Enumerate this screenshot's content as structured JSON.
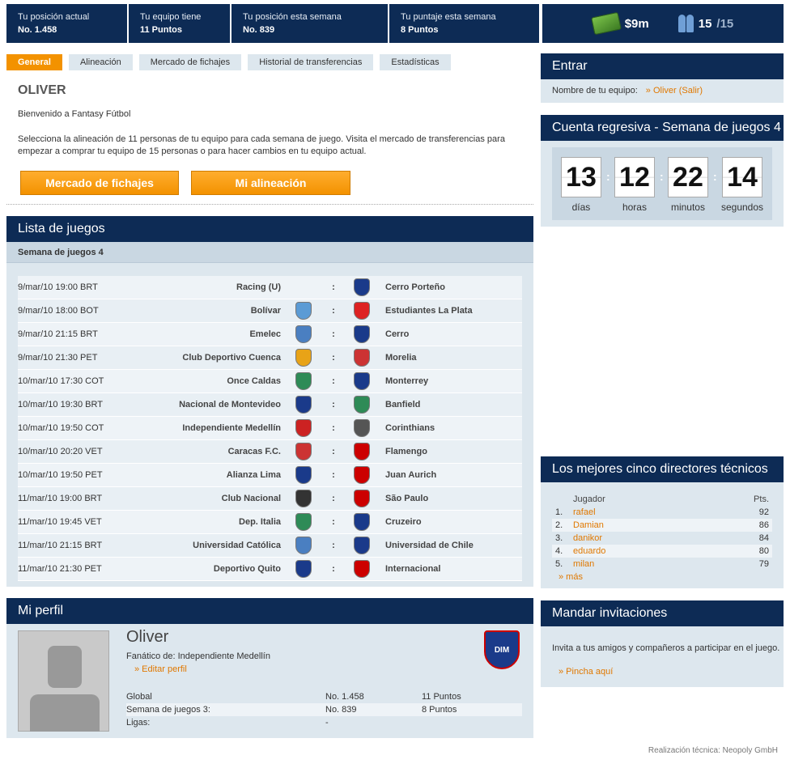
{
  "stats": [
    {
      "label": "Tu posición actual",
      "value": "No. 1.458"
    },
    {
      "label": "Tu equipo tiene",
      "value": "11 Puntos"
    },
    {
      "label": "Tu posición esta semana",
      "value": "No. 839"
    },
    {
      "label": "Tu puntaje esta semana",
      "value": "8 Puntos"
    }
  ],
  "budget": "$9m",
  "players": {
    "count": "15",
    "max": "/15"
  },
  "tabs": [
    "General",
    "Alineación",
    "Mercado de fichajes",
    "Historial de transferencias",
    "Estadísticas"
  ],
  "general": {
    "title": "OLIVER",
    "welcome": "Bienvenido a Fantasy Fútbol",
    "text": "Selecciona la alineación de 11 personas de tu equipo para cada semana de juego. Visita el mercado de transferencias para empezar a comprar tu equipo de 15 personas o para hacer cambios en tu equipo actual.",
    "btn_market": "Mercado de fichajes",
    "btn_lineup": "Mi alineación"
  },
  "games": {
    "title": "Lista de juegos",
    "week": "Semana de juegos 4",
    "sep": ":",
    "matches": [
      {
        "date": "9/mar/10 19:00 BRT",
        "home": "Racing (U)",
        "away": "Cerro Porteño",
        "hc": "",
        "ac": "#1a3a8a"
      },
      {
        "date": "9/mar/10 18:00 BOT",
        "home": "Bolívar",
        "away": "Estudiantes La Plata",
        "hc": "#5b9bd5",
        "ac": "#d22"
      },
      {
        "date": "9/mar/10 21:15 BRT",
        "home": "Emelec",
        "away": "Cerro",
        "hc": "#4a7fc1",
        "ac": "#1a3a8a"
      },
      {
        "date": "9/mar/10 21:30 PET",
        "home": "Club Deportivo Cuenca",
        "away": "Morelia",
        "hc": "#e8a317",
        "ac": "#c33"
      },
      {
        "date": "10/mar/10 17:30 COT",
        "home": "Once Caldas",
        "away": "Monterrey",
        "hc": "#2e8b57",
        "ac": "#1a3a8a"
      },
      {
        "date": "10/mar/10 19:30 BRT",
        "home": "Nacional de Montevideo",
        "away": "Banfield",
        "hc": "#1a3a8a",
        "ac": "#2e8b57"
      },
      {
        "date": "10/mar/10 19:50 COT",
        "home": "Independiente Medellín",
        "away": "Corinthians",
        "hc": "#c22",
        "ac": "#555"
      },
      {
        "date": "10/mar/10 20:20 VET",
        "home": "Caracas F.C.",
        "away": "Flamengo",
        "hc": "#c33",
        "ac": "#c00"
      },
      {
        "date": "10/mar/10 19:50 PET",
        "home": "Alianza Lima",
        "away": "Juan Aurich",
        "hc": "#1a3a8a",
        "ac": "#c00"
      },
      {
        "date": "11/mar/10 19:00 BRT",
        "home": "Club Nacional",
        "away": "São Paulo",
        "hc": "#333",
        "ac": "#c00"
      },
      {
        "date": "11/mar/10 19:45 VET",
        "home": "Dep. Italia",
        "away": "Cruzeiro",
        "hc": "#2e8b57",
        "ac": "#1a3a8a"
      },
      {
        "date": "11/mar/10 21:15 BRT",
        "home": "Universidad Católica",
        "away": "Universidad de Chile",
        "hc": "#4a7fc1",
        "ac": "#1a3a8a"
      },
      {
        "date": "11/mar/10 21:30 PET",
        "home": "Deportivo Quito",
        "away": "Internacional",
        "hc": "#1a3a8a",
        "ac": "#c00"
      }
    ]
  },
  "profile": {
    "title": "Mi perfil",
    "name": "Oliver",
    "fan": "Fanático de: Independiente Medellín",
    "edit": "» Editar perfil",
    "club_logo": "DIM",
    "rows": [
      {
        "label": "Global",
        "pos": "No. 1.458",
        "pts": "11 Puntos"
      },
      {
        "label": "Semana de juegos 3:",
        "pos": "No. 839",
        "pts": "8 Puntos"
      },
      {
        "label": "Ligas:",
        "pos": "-",
        "pts": ""
      }
    ]
  },
  "login": {
    "title": "Entrar",
    "label": "Nombre de tu equipo:",
    "link": "» Oliver (Salir)"
  },
  "countdown": {
    "title": "Cuenta regresiva - Semana de juegos 4",
    "units": [
      {
        "value": "13",
        "label": "días"
      },
      {
        "value": "12",
        "label": "horas"
      },
      {
        "value": "22",
        "label": "minutos"
      },
      {
        "value": "14",
        "label": "segundos"
      }
    ]
  },
  "top5": {
    "title": "Los mejores cinco directores técnicos",
    "col_player": "Jugador",
    "col_pts": "Pts.",
    "rows": [
      {
        "rank": "1.",
        "name": "rafael",
        "pts": "92"
      },
      {
        "rank": "2.",
        "name": "Damian",
        "pts": "86"
      },
      {
        "rank": "3.",
        "name": "danikor",
        "pts": "84"
      },
      {
        "rank": "4.",
        "name": "eduardo",
        "pts": "80"
      },
      {
        "rank": "5.",
        "name": "milan",
        "pts": "79"
      }
    ],
    "more": "» más"
  },
  "invite": {
    "title": "Mandar invitaciones",
    "text": "Invita a tus amigos y compañeros a participar en el juego.",
    "link": "» Pincha aquí"
  },
  "footer": "Realización técnica: Neopoly GmbH"
}
